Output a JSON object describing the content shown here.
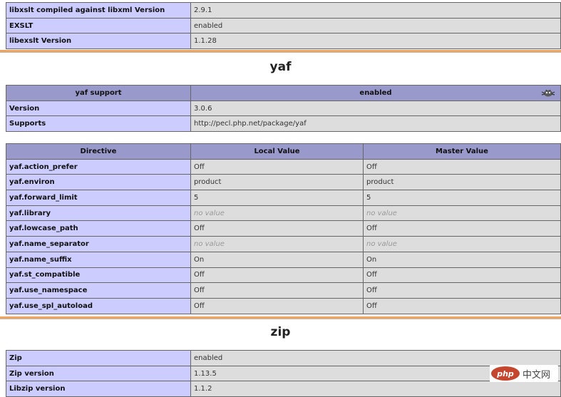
{
  "xsl_tail": {
    "rows": [
      {
        "directive": "libxslt compiled against libxml Version",
        "value": "2.9.1"
      },
      {
        "directive": "EXSLT",
        "value": "enabled"
      },
      {
        "directive": "libexslt Version",
        "value": "1.1.28"
      }
    ]
  },
  "yaf": {
    "title": "yaf",
    "info_header": {
      "label": "yaf support",
      "value": "enabled"
    },
    "logo_icon": "yaf-logo-icon",
    "info_rows": [
      {
        "label": "Version",
        "value": "3.0.6"
      },
      {
        "label": "Supports",
        "value": "http://pecl.php.net/package/yaf"
      }
    ],
    "directives_header": {
      "directive": "Directive",
      "local": "Local Value",
      "master": "Master Value"
    },
    "directives": [
      {
        "name": "yaf.action_prefer",
        "local": "Off",
        "master": "Off"
      },
      {
        "name": "yaf.environ",
        "local": "product",
        "master": "product"
      },
      {
        "name": "yaf.forward_limit",
        "local": "5",
        "master": "5"
      },
      {
        "name": "yaf.library",
        "local": "no value",
        "master": "no value"
      },
      {
        "name": "yaf.lowcase_path",
        "local": "Off",
        "master": "Off"
      },
      {
        "name": "yaf.name_separator",
        "local": "no value",
        "master": "no value"
      },
      {
        "name": "yaf.name_suffix",
        "local": "On",
        "master": "On"
      },
      {
        "name": "yaf.st_compatible",
        "local": "Off",
        "master": "Off"
      },
      {
        "name": "yaf.use_namespace",
        "local": "Off",
        "master": "Off"
      },
      {
        "name": "yaf.use_spl_autoload",
        "local": "Off",
        "master": "Off"
      }
    ]
  },
  "zip": {
    "title": "zip",
    "rows": [
      {
        "label": "Zip",
        "value": "enabled"
      },
      {
        "label": "Zip version",
        "value": "1.13.5"
      },
      {
        "label": "Libzip version",
        "value": "1.1.2"
      }
    ]
  },
  "watermark": {
    "badge": "php",
    "text": "中文网"
  },
  "colors": {
    "key_cell": "#ccccff",
    "value_cell": "#dddddd",
    "header_cell": "#9999cc",
    "separator": "#f0a35c",
    "no_value_text": "#999999"
  }
}
